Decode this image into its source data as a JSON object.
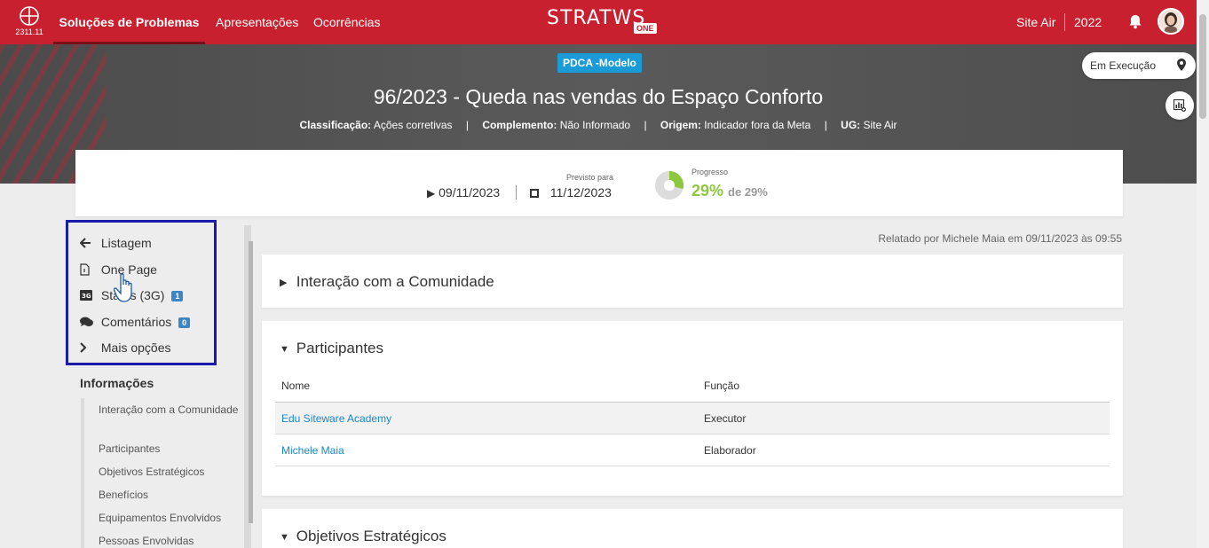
{
  "app": {
    "version": "2311.11",
    "brand": "STRATWS",
    "brand_suffix": "ONE"
  },
  "nav": {
    "items": [
      {
        "label": "Soluções de Problemas",
        "active": true
      },
      {
        "label": "Apresentações",
        "active": false
      },
      {
        "label": "Ocorrências",
        "active": false
      }
    ],
    "site": "Site Air",
    "year": "2022",
    "bell_icon": "bell-icon"
  },
  "hero": {
    "model_badge": "PDCA -Modelo",
    "title": "96/2023 - Queda nas vendas do Espaço Conforto",
    "meta": [
      {
        "label": "Classificação:",
        "value": "Ações corretivas"
      },
      {
        "label": "Complemento:",
        "value": "Não Informado"
      },
      {
        "label": "Origem:",
        "value": "Indicador fora da Meta"
      },
      {
        "label": "UG:",
        "value": "Site Air"
      }
    ],
    "status": "Em Execução"
  },
  "dates": {
    "start": "09/11/2023",
    "planned_label": "Previsto para",
    "end": "11/12/2023",
    "progress_label": "Progresso",
    "progress_value": "29%",
    "progress_of": "de 29%",
    "progress_fraction": 0.29
  },
  "sidebar": {
    "items": [
      {
        "label": "Listagem",
        "icon": "arrow-left-icon"
      },
      {
        "label": "One Page",
        "icon": "document-icon"
      },
      {
        "label": "Status (3G)",
        "icon": "status-3g-icon",
        "badge": "1"
      },
      {
        "label": "Comentários",
        "icon": "comments-icon",
        "badge": "0"
      },
      {
        "label": "Mais opções",
        "icon": "chevron-right-icon"
      }
    ],
    "info_title": "Informações",
    "info_items": [
      "Interação com a Comunidade",
      "Participantes",
      "Objetivos Estratégicos",
      "Benefícios",
      "Equipamentos Envolvidos",
      "Pessoas Envolvidas"
    ]
  },
  "main": {
    "reported": "Relatado por Michele Maia em 09/11/2023 às 09:55",
    "panels": {
      "community": "Interação com a Comunidade",
      "participants": "Participantes",
      "objectives": "Objetivos Estratégicos"
    },
    "participants_table": {
      "headers": [
        "Nome",
        "Função"
      ],
      "rows": [
        {
          "name": "Edu Siteware Academy",
          "role": "Executor"
        },
        {
          "name": "Michele Maia",
          "role": "Elaborador"
        }
      ]
    }
  },
  "colors": {
    "brand_red": "#c8202e",
    "link_blue": "#1a86c8",
    "progress_green": "#8dc63f",
    "highlight_border": "#1a1aa8"
  }
}
